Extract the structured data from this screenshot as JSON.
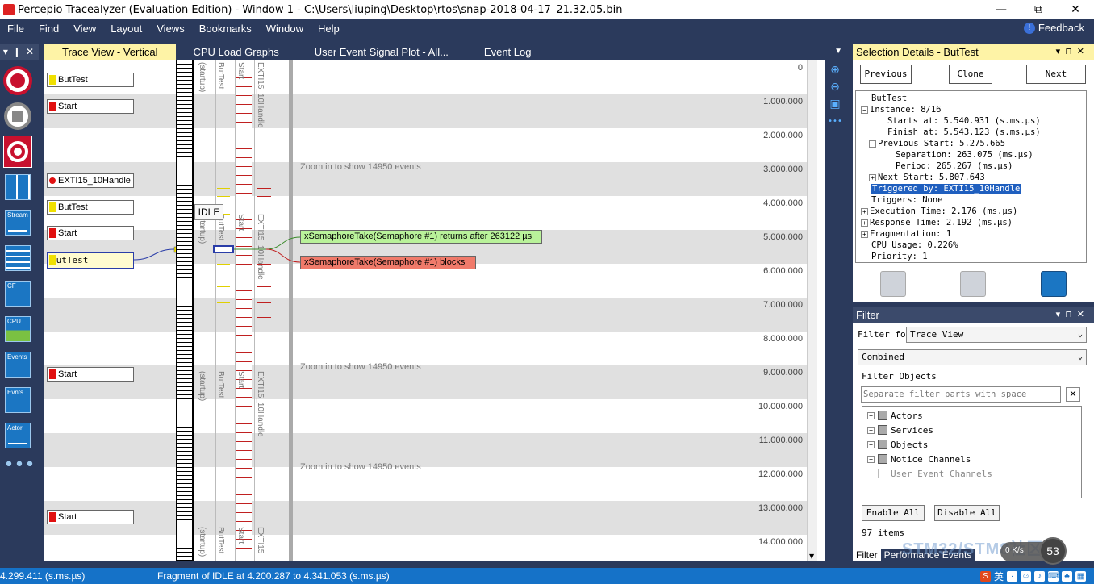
{
  "window": {
    "title": "Percepio Tracealyzer (Evaluation Edition) - Window 1 - C:\\Users\\liuping\\Desktop\\rtos\\snap-2018-04-17_21.32.05.bin",
    "minimize": "—",
    "restore": "⧉",
    "close": "✕"
  },
  "menu": [
    "File",
    "Find",
    "View",
    "Layout",
    "Views",
    "Bookmarks",
    "Window",
    "Help"
  ],
  "feedback": "Feedback",
  "left_panel": {
    "pin": "❙",
    "close": "✕",
    "tools": [
      {
        "icon": "record-icon"
      },
      {
        "icon": "stop-icon"
      },
      {
        "icon": "snapshot-icon"
      },
      {
        "icon": "layout-grid-icon"
      },
      {
        "icon": "stream-icon",
        "label": "Stream"
      },
      {
        "icon": "trace-view-icon"
      },
      {
        "icon": "cf-icon",
        "label": "CF"
      },
      {
        "icon": "cpu-icon",
        "label": "CPU"
      },
      {
        "icon": "events-icon",
        "label": "Events"
      },
      {
        "icon": "evnts-icon",
        "label": "Evnts"
      },
      {
        "icon": "actor-icon",
        "label": "Actor"
      }
    ],
    "more": "•••"
  },
  "tabs": [
    "Trace View - Vertical",
    "CPU Load Graphs",
    "User Event Signal Plot - All...",
    "Event Log"
  ],
  "trace": {
    "ticks": [
      "0",
      "1.000.000",
      "2.000.000",
      "3.000.000",
      "4.000.000",
      "5.000.000",
      "6.000.000",
      "7.000.000",
      "8.000.000",
      "9.000.000",
      "10.000.000",
      "11.000.000",
      "12.000.000",
      "13.000.000",
      "14.000.000"
    ],
    "actor_labels": [
      {
        "text": "ButTest",
        "color": "yellow"
      },
      {
        "text": "Start",
        "color": "red"
      },
      {
        "text": "EXTI15_10Handle",
        "color": "red-dot"
      },
      {
        "text": "ButTest",
        "color": "yellow"
      },
      {
        "text": "Start",
        "color": "red"
      },
      {
        "text": "ButTest",
        "color": "yellow",
        "selected": true
      },
      {
        "text": "Start",
        "color": "red"
      },
      {
        "text": "Start",
        "color": "red"
      }
    ],
    "column_labels": [
      "(startup)",
      "ButTest",
      "Start",
      "EXTI15_10Handle"
    ],
    "column_labels_trunc": [
      "(startup)",
      "ButTest",
      "Start",
      "EXTI15"
    ],
    "column_labels_mid": [
      "(startup)",
      "ButTest",
      "Start",
      "EXTI15_10Handle"
    ],
    "zoom_msg": "Zoom in to show 14950 events",
    "tooltip": "IDLE",
    "event_green": "xSemaphoreTake(Semaphore #1) returns after 263122 µs",
    "event_red": "xSemaphoreTake(Semaphore #1) blocks"
  },
  "selection_details": {
    "title": "Selection Details - ButTest",
    "buttons": [
      "Previous",
      "Clone",
      "Next"
    ],
    "tree": [
      {
        "text": "ButTest",
        "indent": 0,
        "exp": ""
      },
      {
        "text": "Instance: 8/16",
        "indent": 0,
        "exp": "-"
      },
      {
        "text": "Starts at: 5.540.931 (s.ms.µs)",
        "indent": 2,
        "exp": ""
      },
      {
        "text": "Finish at: 5.543.123 (s.ms.µs)",
        "indent": 2,
        "exp": ""
      },
      {
        "text": "Previous Start: 5.275.665",
        "indent": 1,
        "exp": "-"
      },
      {
        "text": "Separation: 263.075 (ms.µs)",
        "indent": 3,
        "exp": ""
      },
      {
        "text": "Period: 265.267 (ms.µs)",
        "indent": 3,
        "exp": ""
      },
      {
        "text": "Next Start: 5.807.643",
        "indent": 1,
        "exp": "+"
      },
      {
        "text": "Triggered by: EXTI15_10Handle",
        "indent": 0,
        "exp": "",
        "hl": true
      },
      {
        "text": "Triggers: None",
        "indent": 0,
        "exp": ""
      },
      {
        "text": "Execution Time: 2.176 (ms.µs)",
        "indent": 0,
        "exp": "+"
      },
      {
        "text": "Response Time: 2.192 (ms.µs)",
        "indent": 0,
        "exp": "+"
      },
      {
        "text": "Fragmentation: 1",
        "indent": 0,
        "exp": "+"
      },
      {
        "text": "CPU Usage: 0.226%",
        "indent": 0,
        "exp": ""
      },
      {
        "text": "Priority: 1",
        "indent": 0,
        "exp": ""
      }
    ]
  },
  "filter": {
    "title": "Filter",
    "filter_for_label": "Filter for",
    "filter_for_value": "Trace View",
    "mode_value": "Combined",
    "objects_label": "Filter Objects",
    "search_placeholder": "Separate filter parts with space",
    "clear": "✕",
    "items": [
      {
        "text": "Actors",
        "checked": true
      },
      {
        "text": "Services",
        "checked": true
      },
      {
        "text": "Objects",
        "checked": true
      },
      {
        "text": "Notice Channels",
        "checked": true
      },
      {
        "text": "User Event Channels",
        "checked": false
      }
    ],
    "enable_all": "Enable All",
    "disable_all": "Disable All",
    "count": "97 items"
  },
  "panel_tabs": [
    "Filter",
    "Performance Events"
  ],
  "status": {
    "left": "4.299.411 (s.ms.µs)",
    "mid": "Fragment of IDLE at 4.200.287 to 4.341.053 (s.ms.µs)"
  },
  "tray": {
    "ime": "英",
    "speed": "0 K/s",
    "speed_pct": "53"
  },
  "watermark": "STM32/STM8社区",
  "colors": {
    "accent": "#2b3a5c",
    "tab_active": "#fef3a6",
    "status": "#1572c8",
    "record": "#c8102e"
  }
}
